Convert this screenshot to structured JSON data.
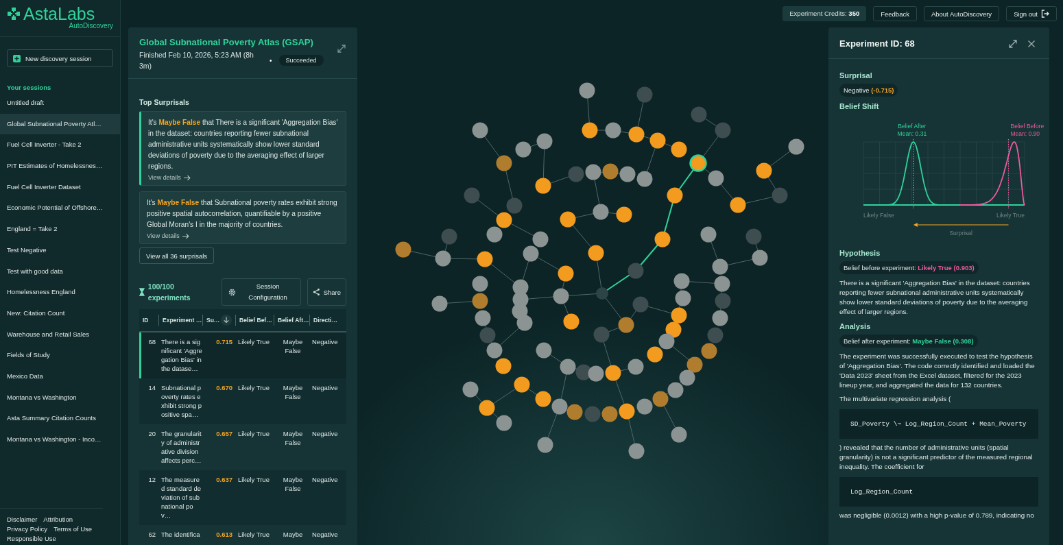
{
  "top_bar": {
    "credits": "Experiment Credits: **350**",
    "buttons": [
      "Feedback",
      "About AutoDiscovery"
    ],
    "sign_out": "Sign out"
  },
  "sidebar": {
    "logo": "AstaLabs",
    "subtitle": "AutoDiscovery",
    "new_session": "New discovery session",
    "sessions_heading": "Your sessions",
    "sessions": [
      {
        "label": "Untitled draft",
        "selected": false
      },
      {
        "label": "Global Subnational Poverty Atl…",
        "selected": true
      },
      {
        "label": "Fuel Cell Inverter - Take 2",
        "selected": false
      },
      {
        "label": "PIT Estimates of Homelessnes…",
        "selected": false
      },
      {
        "label": "Fuel Cell Inverter Dataset",
        "selected": false
      },
      {
        "label": "Economic Potential of Offshore…",
        "selected": false
      },
      {
        "label": "England = Take 2",
        "selected": false
      },
      {
        "label": "Test Negative",
        "selected": false
      },
      {
        "label": "Test with good data",
        "selected": false
      },
      {
        "label": "Homelessness England",
        "selected": false
      },
      {
        "label": "New: Citation Count",
        "selected": false
      },
      {
        "label": "Warehouse and Retail Sales",
        "selected": false
      },
      {
        "label": "Fields of Study",
        "selected": false
      },
      {
        "label": "Mexico Data",
        "selected": false
      },
      {
        "label": "Montana vs Washington",
        "selected": false
      },
      {
        "label": "Asta Summary Citation Counts",
        "selected": false
      },
      {
        "label": "Montana vs Washington - Inco…",
        "selected": false
      }
    ],
    "footer_links": [
      "Disclaimer",
      "Attribution",
      "Privacy Policy",
      "Terms of Use",
      "Responsible Use"
    ]
  },
  "session": {
    "title": "Global Subnational Poverty Atlas (GSAP)",
    "finished": "Finished Feb 10, 2026, 5:23 AM (8h 3m)",
    "separator": "•",
    "status": "Succeeded",
    "surprisals_heading": "Top Surprisals",
    "surprisals": [
      {
        "text": "It's **Maybe False** that There is a significant 'Aggregation Bias' in the dataset: countries reporting fewer subnational administrative units systematically show lower standard deviations of poverty due to the averaging effect of larger regions.",
        "link": "View details",
        "selected": true
      },
      {
        "text": "It's **Maybe False** that Subnational poverty rates exhibit strong positive spatial autocorrelation, quantifiable by a positive Global Moran's I in the majority of countries.",
        "link": "View details",
        "selected": false
      }
    ],
    "view_all": "View all 36 surprisals",
    "progress": "100/100 experiments",
    "config_button": "Session Configuration",
    "share_button": "Share"
  },
  "table": {
    "columns": [
      "ID",
      "Experiment …",
      "Su…",
      "Belief Bef…",
      "Belief Aft…",
      "Directi…"
    ],
    "rows": [
      {
        "id": "68",
        "experiment": "There is a significant 'Aggregation Bias' in the datase…",
        "surprisal": "0.715",
        "belief_before": "Likely True",
        "belief_after": "Maybe False",
        "direction": "Negative",
        "selected": true
      },
      {
        "id": "14",
        "experiment": "Subnational poverty rates exhibit strong positive spa…",
        "surprisal": "0.670",
        "belief_before": "Likely True",
        "belief_after": "Maybe False",
        "direction": "Negative",
        "selected": false
      },
      {
        "id": "20",
        "experiment": "The granularity of administrative division affects perc…",
        "surprisal": "0.657",
        "belief_before": "Likely True",
        "belief_after": "Maybe False",
        "direction": "Negative",
        "selected": false
      },
      {
        "id": "12",
        "experiment": "The measured standard deviation of subnational pov…",
        "surprisal": "0.637",
        "belief_before": "Likely True",
        "belief_after": "Maybe False",
        "direction": "Negative",
        "selected": false
      },
      {
        "id": "62",
        "experiment": "The identifica",
        "surprisal": "0.613",
        "belief_before": "Likely True",
        "belief_after": "Maybe",
        "direction": "Negative",
        "selected": false
      }
    ]
  },
  "experiment": {
    "title": "Experiment ID: 68",
    "sections": [
      {
        "heading": "Surprisal",
        "badge": "Negative **(-0.715)**",
        "color": "#f5a524"
      },
      {
        "heading": "Belief Shift",
        "chart": {
          "after_label": "Belief After",
          "after_mean": "Mean: 0.31",
          "before_label": "Belief Before",
          "before_mean": "Mean: 0.90",
          "left_label": "Likely False",
          "right_label": "Likely True",
          "arrow_label": "Surprisal"
        }
      },
      {
        "heading": "Hypothesis",
        "badge": "Belief before experiment: **Likely True (0.903)**",
        "color": "#ec5a9f",
        "blocks": [
          {
            "kind": "text",
            "text": "There is a significant 'Aggregation Bias' in the dataset: countries reporting fewer subnational administrative units systematically show lower standard deviations of poverty due to the averaging effect of larger regions."
          }
        ]
      },
      {
        "heading": "Analysis",
        "badge": "Belief after experiment: **Maybe False (0.308)**",
        "color": "#2fd39a",
        "blocks": [
          {
            "kind": "text",
            "text": "The experiment was successfully executed to test the hypothesis of 'Aggregation Bias'. The code correctly identified and loaded the 'Data 2023' sheet from the Excel dataset, filtered for the 2023 lineup year, and aggregated the data for 132 countries."
          },
          {
            "kind": "text",
            "text": "The multivariate regression analysis ("
          },
          {
            "kind": "code",
            "text": "SD_Poverty \\~ Log_Region_Count + Mean_Poverty"
          },
          {
            "kind": "text",
            "text": ") revealed that the number of administrative units (spatial granularity) is not a significant predictor of the measured regional inequality. The coefficient for"
          },
          {
            "kind": "code",
            "text": "Log_Region_Count"
          },
          {
            "kind": "text",
            "text": "was negligible (0.0012) with a high p-value of 0.789, indicating no"
          }
        ]
      }
    ]
  }
}
